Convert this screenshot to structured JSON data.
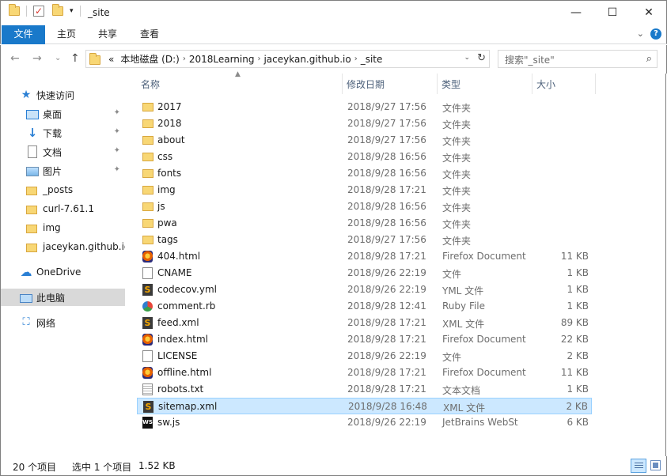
{
  "window": {
    "title": "_site"
  },
  "window_controls": {
    "minimize": "—",
    "maximize": "☐",
    "close": "✕"
  },
  "ribbon": {
    "file_tab": "文件",
    "tabs": [
      "主页",
      "共享",
      "查看"
    ],
    "expand_glyph": "⌄",
    "help_glyph": "?"
  },
  "address": {
    "back_glyph": "←",
    "forward_glyph": "→",
    "recent_glyph": "⌄",
    "up_glyph": "↑",
    "overflow": "«",
    "crumbs": [
      "本地磁盘 (D:)",
      "2018Learning",
      "jaceykan.github.io",
      "_site"
    ],
    "refresh_glyph": "↻"
  },
  "search": {
    "placeholder": "搜索\"_site\"",
    "icon_glyph": "⌕"
  },
  "nav": {
    "quick_access": "快速访问",
    "pinned": [
      {
        "label": "桌面",
        "icon": "desktop-icon"
      },
      {
        "label": "下载",
        "icon": "download-icon"
      },
      {
        "label": "文档",
        "icon": "document-icon"
      },
      {
        "label": "图片",
        "icon": "pictures-icon"
      }
    ],
    "recent": [
      "_posts",
      "curl-7.61.1",
      "img",
      "jaceykan.github.io"
    ],
    "onedrive": "OneDrive",
    "this_pc": "此电脑",
    "network": "网络",
    "glyphs": {
      "star": "★",
      "down": "↓",
      "cloud": "☁",
      "net": "⛶",
      "pin": "📌"
    }
  },
  "columns": {
    "name": "名称",
    "date": "修改日期",
    "type": "类型",
    "size": "大小"
  },
  "files": [
    {
      "name": "2017",
      "date": "2018/9/27 17:56",
      "type": "文件夹",
      "size": "",
      "icon": "folder"
    },
    {
      "name": "2018",
      "date": "2018/9/27 17:56",
      "type": "文件夹",
      "size": "",
      "icon": "folder"
    },
    {
      "name": "about",
      "date": "2018/9/27 17:56",
      "type": "文件夹",
      "size": "",
      "icon": "folder"
    },
    {
      "name": "css",
      "date": "2018/9/28 16:56",
      "type": "文件夹",
      "size": "",
      "icon": "folder"
    },
    {
      "name": "fonts",
      "date": "2018/9/28 16:56",
      "type": "文件夹",
      "size": "",
      "icon": "folder"
    },
    {
      "name": "img",
      "date": "2018/9/28 17:21",
      "type": "文件夹",
      "size": "",
      "icon": "folder"
    },
    {
      "name": "js",
      "date": "2018/9/28 16:56",
      "type": "文件夹",
      "size": "",
      "icon": "folder"
    },
    {
      "name": "pwa",
      "date": "2018/9/28 16:56",
      "type": "文件夹",
      "size": "",
      "icon": "folder"
    },
    {
      "name": "tags",
      "date": "2018/9/27 17:56",
      "type": "文件夹",
      "size": "",
      "icon": "folder"
    },
    {
      "name": "404.html",
      "date": "2018/9/28 17:21",
      "type": "Firefox Document",
      "size": "11 KB",
      "icon": "firefox"
    },
    {
      "name": "CNAME",
      "date": "2018/9/26 22:19",
      "type": "文件",
      "size": "1 KB",
      "icon": "blank"
    },
    {
      "name": "codecov.yml",
      "date": "2018/9/26 22:19",
      "type": "YML 文件",
      "size": "1 KB",
      "icon": "yml"
    },
    {
      "name": "comment.rb",
      "date": "2018/9/28 12:41",
      "type": "Ruby File",
      "size": "1 KB",
      "icon": "ruby"
    },
    {
      "name": "feed.xml",
      "date": "2018/9/28 17:21",
      "type": "XML 文件",
      "size": "89 KB",
      "icon": "yml"
    },
    {
      "name": "index.html",
      "date": "2018/9/28 17:21",
      "type": "Firefox Document",
      "size": "22 KB",
      "icon": "firefox"
    },
    {
      "name": "LICENSE",
      "date": "2018/9/26 22:19",
      "type": "文件",
      "size": "2 KB",
      "icon": "blank"
    },
    {
      "name": "offline.html",
      "date": "2018/9/28 17:21",
      "type": "Firefox Document",
      "size": "11 KB",
      "icon": "firefox"
    },
    {
      "name": "robots.txt",
      "date": "2018/9/28 17:21",
      "type": "文本文档",
      "size": "1 KB",
      "icon": "txt"
    },
    {
      "name": "sitemap.xml",
      "date": "2018/9/28 16:48",
      "type": "XML 文件",
      "size": "2 KB",
      "icon": "yml",
      "selected": true
    },
    {
      "name": "sw.js",
      "date": "2018/9/26 22:19",
      "type": "JetBrains WebSt",
      "size": "6 KB",
      "icon": "ws"
    }
  ],
  "icon_glyphs": {
    "yml": "S",
    "ws": "WS"
  },
  "status": {
    "count": "20 个项目",
    "selected": "选中 1 个项目",
    "size": "1.52 KB"
  },
  "colors": {
    "accent": "#1979ca",
    "selection": "#cce8ff",
    "selection_border": "#99d1ff",
    "nav_selected": "#d9d9d9"
  }
}
